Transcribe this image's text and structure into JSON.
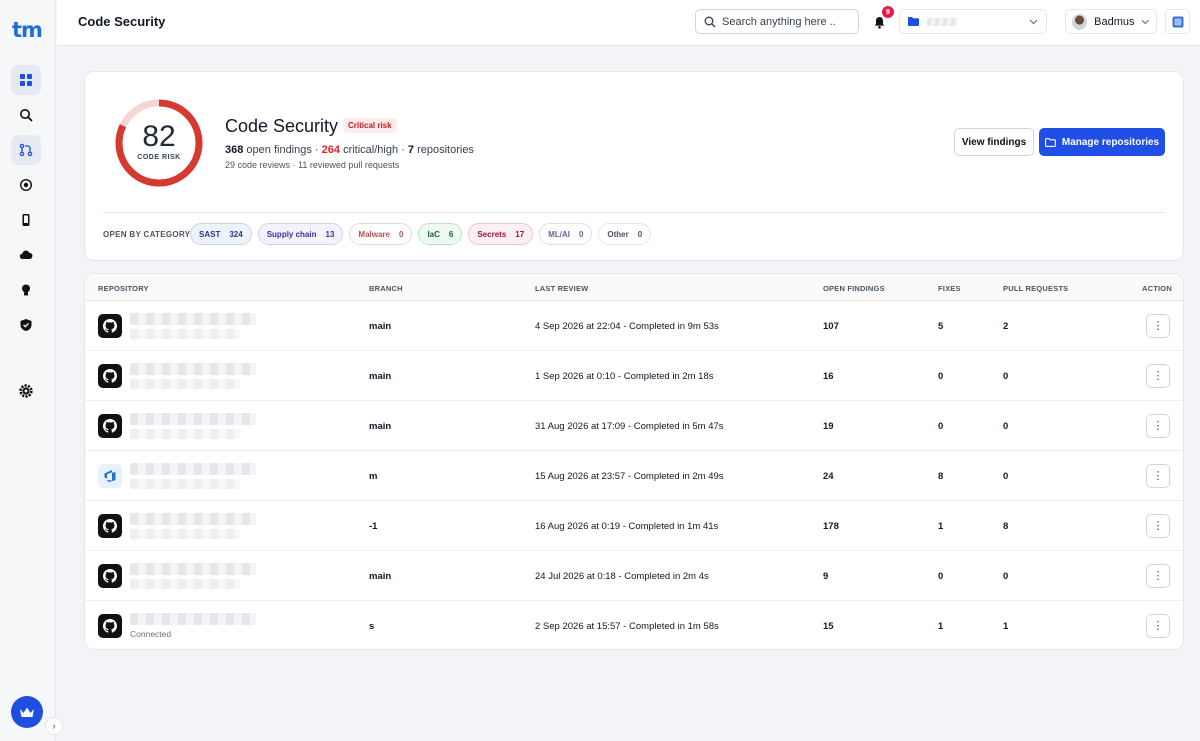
{
  "app": {
    "logo": "tm"
  },
  "header": {
    "title": "Code Security",
    "search_placeholder": "Search anything here ..",
    "notifications_count": "9",
    "user_name": "Badmus"
  },
  "summary": {
    "score": "82",
    "score_label": "CODE RISK",
    "score_value": 0.82,
    "title": "Code Security",
    "risk_badge": "Critical risk",
    "open_findings": "368",
    "open_findings_text": "open findings",
    "critical_high": "264",
    "critical_high_text": "critical/high",
    "repositories": "7",
    "repositories_text": "repositories",
    "sub_stats": "29 code reviews · 11 reviewed pull requests",
    "view_findings_label": "View findings",
    "manage_repos_label": "Manage repositories",
    "category_label": "OPEN BY CATEGORY",
    "categories": [
      {
        "name": "SAST",
        "count": "324",
        "color": "#1e3a8a",
        "bg": "#eef2fb",
        "border": "#c7d2ea"
      },
      {
        "name": "Supply chain",
        "count": "13",
        "color": "#3730a3",
        "bg": "#f3f2fd",
        "border": "#d4d0f2"
      },
      {
        "name": "Malware",
        "count": "0",
        "color": "#b45353",
        "bg": "#fff",
        "border": "#f1d5d5"
      },
      {
        "name": "IaC",
        "count": "6",
        "color": "#166534",
        "bg": "#eefaf1",
        "border": "#bfe3c9"
      },
      {
        "name": "Secrets",
        "count": "17",
        "color": "#9f1239",
        "bg": "#fdf0f2",
        "border": "#f2c4cd"
      },
      {
        "name": "ML/AI",
        "count": "0",
        "color": "#6d5aa8",
        "bg": "#fff",
        "border": "#e2dcf0"
      },
      {
        "name": "Other",
        "count": "0",
        "color": "#4b5563",
        "bg": "#fff",
        "border": "#e5e7eb"
      }
    ]
  },
  "table": {
    "headers": {
      "repository": "REPOSITORY",
      "branch": "BRANCH",
      "last_review": "LAST REVIEW",
      "open_findings": "OPEN FINDINGS",
      "fixes": "FIXES",
      "pull_requests": "PULL REQUESTS",
      "action": "ACTION"
    },
    "rows": [
      {
        "provider": "github",
        "branch": "main",
        "last_review": "4 Sep 2026 at 22:04 - Completed in 9m 53s",
        "open_findings": "107",
        "fixes": "5",
        "pull_requests": "2",
        "status": ""
      },
      {
        "provider": "github",
        "branch": "main",
        "last_review": "1 Sep 2026 at 0:10 - Completed in 2m 18s",
        "open_findings": "16",
        "fixes": "0",
        "pull_requests": "0",
        "status": ""
      },
      {
        "provider": "github",
        "branch": "main",
        "last_review": "31 Aug 2026 at 17:09 - Completed in 5m 47s",
        "open_findings": "19",
        "fixes": "0",
        "pull_requests": "0",
        "status": ""
      },
      {
        "provider": "azure",
        "branch": "m",
        "last_review": "15 Aug 2026 at 23:57 - Completed in 2m 49s",
        "open_findings": "24",
        "fixes": "8",
        "pull_requests": "0",
        "status": ""
      },
      {
        "provider": "github",
        "branch": "-1",
        "last_review": "16 Aug 2026 at 0:19 - Completed in 1m 41s",
        "open_findings": "178",
        "fixes": "1",
        "pull_requests": "8",
        "status": ""
      },
      {
        "provider": "github",
        "branch": "main",
        "last_review": "24 Jul 2026 at 0:18 - Completed in 2m 4s",
        "open_findings": "9",
        "fixes": "0",
        "pull_requests": "0",
        "status": ""
      },
      {
        "provider": "github",
        "branch": "s",
        "last_review": "2 Sep 2026 at 15:57 - Completed in 1m 58s",
        "open_findings": "15",
        "fixes": "1",
        "pull_requests": "1",
        "status": "Connected"
      }
    ],
    "action_glyph": "⋮"
  },
  "colors": {
    "accent": "#1f4fe6",
    "risk": "#d63a2f",
    "risk_track": "#f3d6d3"
  },
  "icons": {
    "sidebar": [
      "dashboard-icon",
      "search-scan-icon",
      "git-pull-request-icon",
      "target-icon",
      "mobile-icon",
      "cloud-icon",
      "lightbulb-icon",
      "shield-icon",
      "settings-icon"
    ],
    "upgrade": "crown-icon"
  }
}
